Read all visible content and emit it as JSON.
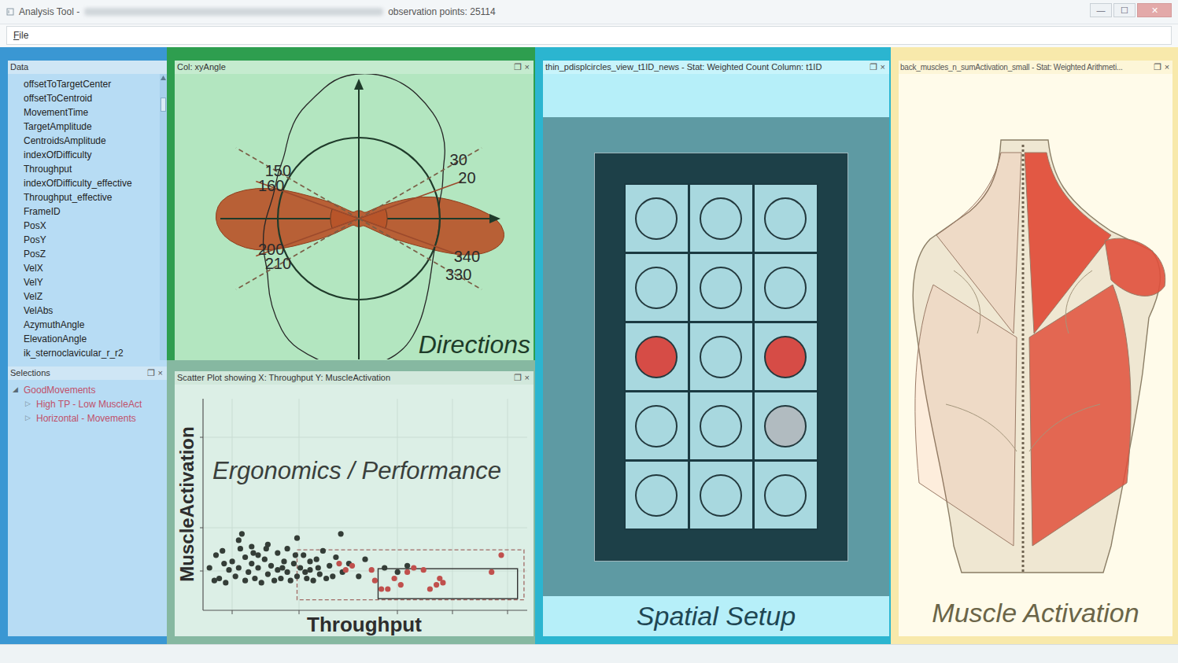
{
  "window": {
    "title": "Analysis Tool -",
    "info": "observation points: 25114",
    "controls": [
      "—",
      "☐",
      "✕"
    ]
  },
  "menu": [
    "File"
  ],
  "data_panel": {
    "title": "Data",
    "items": [
      "offsetToTargetCenter",
      "offsetToCentroid",
      "MovementTime",
      "TargetAmplitude",
      "CentroidsAmplitude",
      "indexOfDifficulty",
      "Throughput",
      "indexOfDifficulty_effective",
      "Throughput_effective",
      "FrameID",
      "PosX",
      "PosY",
      "PosZ",
      "VelX",
      "VelY",
      "VelZ",
      "VelAbs",
      "AzymuthAngle",
      "ElevationAngle",
      "ik_sternoclavicular_r_r2"
    ]
  },
  "selections_panel": {
    "title": "Selections",
    "buttons": [
      "❐",
      "×"
    ],
    "tree": [
      {
        "label": "GoodMovements",
        "icon": "◢",
        "expanded": true,
        "children": [
          {
            "label": "High TP - Low MuscleAct",
            "icon": "▷",
            "expanded": false
          },
          {
            "label": "Horizontal - Movements",
            "icon": "▷",
            "expanded": false
          }
        ]
      }
    ]
  },
  "directions": {
    "title": "Col: xyAngle",
    "buttons": [
      "❐",
      "×"
    ],
    "label": "Directions",
    "outline": [
      1.0,
      1.0,
      1.1,
      1.2,
      1.4,
      1.55,
      1.65,
      1.75,
      1.8,
      1.8,
      1.75,
      1.6,
      1.5,
      1.35,
      1.2,
      1.15,
      1.1,
      1.1,
      1.15,
      1.2,
      1.25,
      1.3,
      1.45,
      1.6,
      1.75,
      1.8,
      1.85,
      1.85,
      1.8,
      1.7,
      1.5,
      1.3,
      1.15,
      1.05,
      1.0,
      1.0
    ],
    "selected": [
      1.75,
      1.25,
      0.85,
      0.35,
      0.12,
      0.1,
      0.1,
      0.1,
      0.1,
      0.1,
      0.1,
      0.1,
      0.1,
      0.1,
      0.15,
      0.45,
      1.2,
      1.7,
      1.8,
      1.65,
      1.25,
      0.5,
      0.15,
      0.1,
      0.1,
      0.1,
      0.1,
      0.1,
      0.1,
      0.1,
      0.1,
      0.12,
      0.2,
      0.55,
      1.45,
      1.85
    ],
    "sectors": [
      {
        "from": 160,
        "to": 200
      },
      {
        "from": 340,
        "to": 380
      }
    ],
    "marks": [
      {
        "label": "150",
        "angle": 150,
        "kind": "dashed"
      },
      {
        "label": "160",
        "angle": 160,
        "kind": "solid"
      },
      {
        "label": "200",
        "angle": 200,
        "kind": "solid"
      },
      {
        "label": "210",
        "angle": 210,
        "kind": "dashed"
      },
      {
        "label": "30",
        "angle": 30,
        "kind": "dashed"
      },
      {
        "label": "20",
        "angle": 20,
        "kind": "solid"
      },
      {
        "label": "340",
        "angle": 340,
        "kind": "solid"
      },
      {
        "label": "330",
        "angle": 330,
        "kind": "dashed"
      }
    ]
  },
  "scatter": {
    "title": "Scatter Plot showing X: Throughput Y: MuscleActivation",
    "buttons": [
      "❐",
      "×"
    ],
    "label": "Ergonomics / Performance",
    "x_label": "Throughput",
    "y_label": "MuscleActivation",
    "series": [
      {
        "color": "#343d37",
        "points": [
          [
            0.2,
            2.0
          ],
          [
            0.4,
            2.6
          ],
          [
            0.5,
            1.5
          ],
          [
            0.6,
            2.8
          ],
          [
            0.7,
            1.3
          ],
          [
            0.8,
            1.9
          ],
          [
            0.9,
            2.3
          ],
          [
            1.0,
            1.6
          ],
          [
            1.1,
            3.3
          ],
          [
            1.1,
            2.0
          ],
          [
            1.2,
            3.6
          ],
          [
            1.3,
            2.5
          ],
          [
            1.3,
            1.4
          ],
          [
            1.4,
            1.8
          ],
          [
            1.5,
            2.2
          ],
          [
            1.5,
            3.0
          ],
          [
            1.6,
            1.5
          ],
          [
            1.7,
            2.6
          ],
          [
            1.7,
            2.0
          ],
          [
            1.8,
            1.3
          ],
          [
            1.9,
            2.4
          ],
          [
            2.0,
            1.7
          ],
          [
            2.0,
            3.1
          ],
          [
            2.1,
            2.1
          ],
          [
            2.2,
            1.4
          ],
          [
            2.3,
            2.7
          ],
          [
            2.3,
            1.9
          ],
          [
            2.4,
            1.5
          ],
          [
            2.5,
            2.3
          ],
          [
            2.6,
            1.8
          ],
          [
            2.6,
            2.9
          ],
          [
            2.7,
            1.4
          ],
          [
            2.8,
            2.2
          ],
          [
            2.9,
            3.4
          ],
          [
            2.9,
            1.6
          ],
          [
            3.0,
            2.0
          ],
          [
            3.1,
            2.6
          ],
          [
            3.2,
            1.5
          ],
          [
            3.3,
            2.3
          ],
          [
            3.3,
            1.9
          ],
          [
            3.4,
            1.4
          ],
          [
            3.5,
            2.4
          ],
          [
            3.6,
            1.7
          ],
          [
            3.7,
            2.8
          ],
          [
            3.8,
            1.5
          ],
          [
            3.9,
            2.1
          ],
          [
            4.0,
            1.6
          ],
          [
            4.1,
            2.5
          ],
          [
            4.25,
            3.6
          ],
          [
            4.3,
            1.8
          ],
          [
            4.5,
            2.2
          ],
          [
            4.8,
            1.6
          ],
          [
            5.0,
            2.4
          ],
          [
            5.6,
            2.0
          ],
          [
            6.0,
            1.8
          ],
          [
            6.3,
            2.1
          ],
          [
            1.15,
            2.9
          ],
          [
            0.65,
            2.2
          ],
          [
            1.95,
            2.9
          ],
          [
            2.85,
            2.6
          ],
          [
            3.55,
            2.0
          ],
          [
            0.35,
            1.4
          ],
          [
            1.55,
            2.7
          ],
          [
            2.45,
            2.0
          ],
          [
            3.15,
            1.8
          ]
        ]
      },
      {
        "color": "#c0504d",
        "points": [
          [
            4.2,
            2.2
          ],
          [
            4.4,
            1.9
          ],
          [
            4.6,
            2.1
          ],
          [
            5.2,
            1.9
          ],
          [
            5.3,
            1.4
          ],
          [
            5.5,
            1.0
          ],
          [
            5.7,
            1.0
          ],
          [
            5.9,
            1.5
          ],
          [
            6.1,
            1.2
          ],
          [
            6.3,
            1.8
          ],
          [
            6.5,
            2.0
          ],
          [
            6.8,
            1.9
          ],
          [
            7.0,
            1.0
          ],
          [
            7.2,
            1.2
          ],
          [
            7.3,
            1.5
          ],
          [
            7.4,
            1.3
          ],
          [
            8.9,
            1.8
          ],
          [
            9.2,
            2.6
          ]
        ]
      }
    ],
    "selections": [
      {
        "kind": "dashed",
        "x": [
          2.9,
          9.9
        ],
        "y": [
          0.5,
          2.85
        ]
      },
      {
        "kind": "solid",
        "x": [
          5.4,
          9.7
        ],
        "y": [
          0.55,
          1.96
        ]
      }
    ]
  },
  "spatial": {
    "title": "thin_pdisplcircles_view_t1ID_news - Stat: Weighted Count Column: t1ID",
    "buttons": [
      "❐",
      "×"
    ],
    "label": "Spatial Setup",
    "cells": [
      {
        "level": 0
      },
      {
        "level": 0
      },
      {
        "level": 0
      },
      {
        "level": 0
      },
      {
        "level": 0
      },
      {
        "level": 0
      },
      {
        "level": 1
      },
      {
        "level": 0
      },
      {
        "level": 1
      },
      {
        "level": 0
      },
      {
        "level": 0
      },
      {
        "level": 0.2
      },
      {
        "level": 0
      },
      {
        "level": 0
      },
      {
        "level": 0
      }
    ]
  },
  "muscles": {
    "title": "back_muscles_n_sumActivation_small - Stat: Weighted Arithmeti...",
    "buttons": [
      "❐",
      "×"
    ],
    "label": "Muscle Activation",
    "regions": [
      {
        "level": 0.95
      },
      {
        "level": 0.9
      },
      {
        "level": 0.85
      },
      {
        "level": 0.08
      },
      {
        "level": 0.08
      }
    ]
  }
}
